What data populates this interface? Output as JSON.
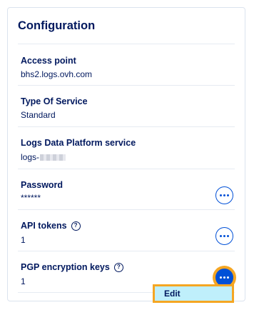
{
  "card": {
    "title": "Configuration"
  },
  "rows": [
    {
      "label": "Access point",
      "value": "bhs2.logs.ovh.com"
    },
    {
      "label": "Type Of Service",
      "value": "Standard"
    },
    {
      "label": "Logs Data Platform service",
      "value": "logs-"
    },
    {
      "label": "Password",
      "value": "******",
      "action_icon": "more-icon"
    },
    {
      "label": "API tokens",
      "value": "1",
      "help_icon": "help-icon",
      "help_text": "?",
      "action_icon": "more-icon"
    },
    {
      "label": "PGP encryption keys",
      "value": "1",
      "help_icon": "help-icon",
      "help_text": "?",
      "action_icon": "more-icon",
      "active": true
    }
  ],
  "menu": {
    "items": [
      {
        "label": "Edit"
      }
    ]
  },
  "colors": {
    "primary": "#0050d7",
    "text": "#00185e",
    "highlight": "#f5a623",
    "menu_bg": "#bfeffb",
    "divider": "#e6ebf2"
  }
}
